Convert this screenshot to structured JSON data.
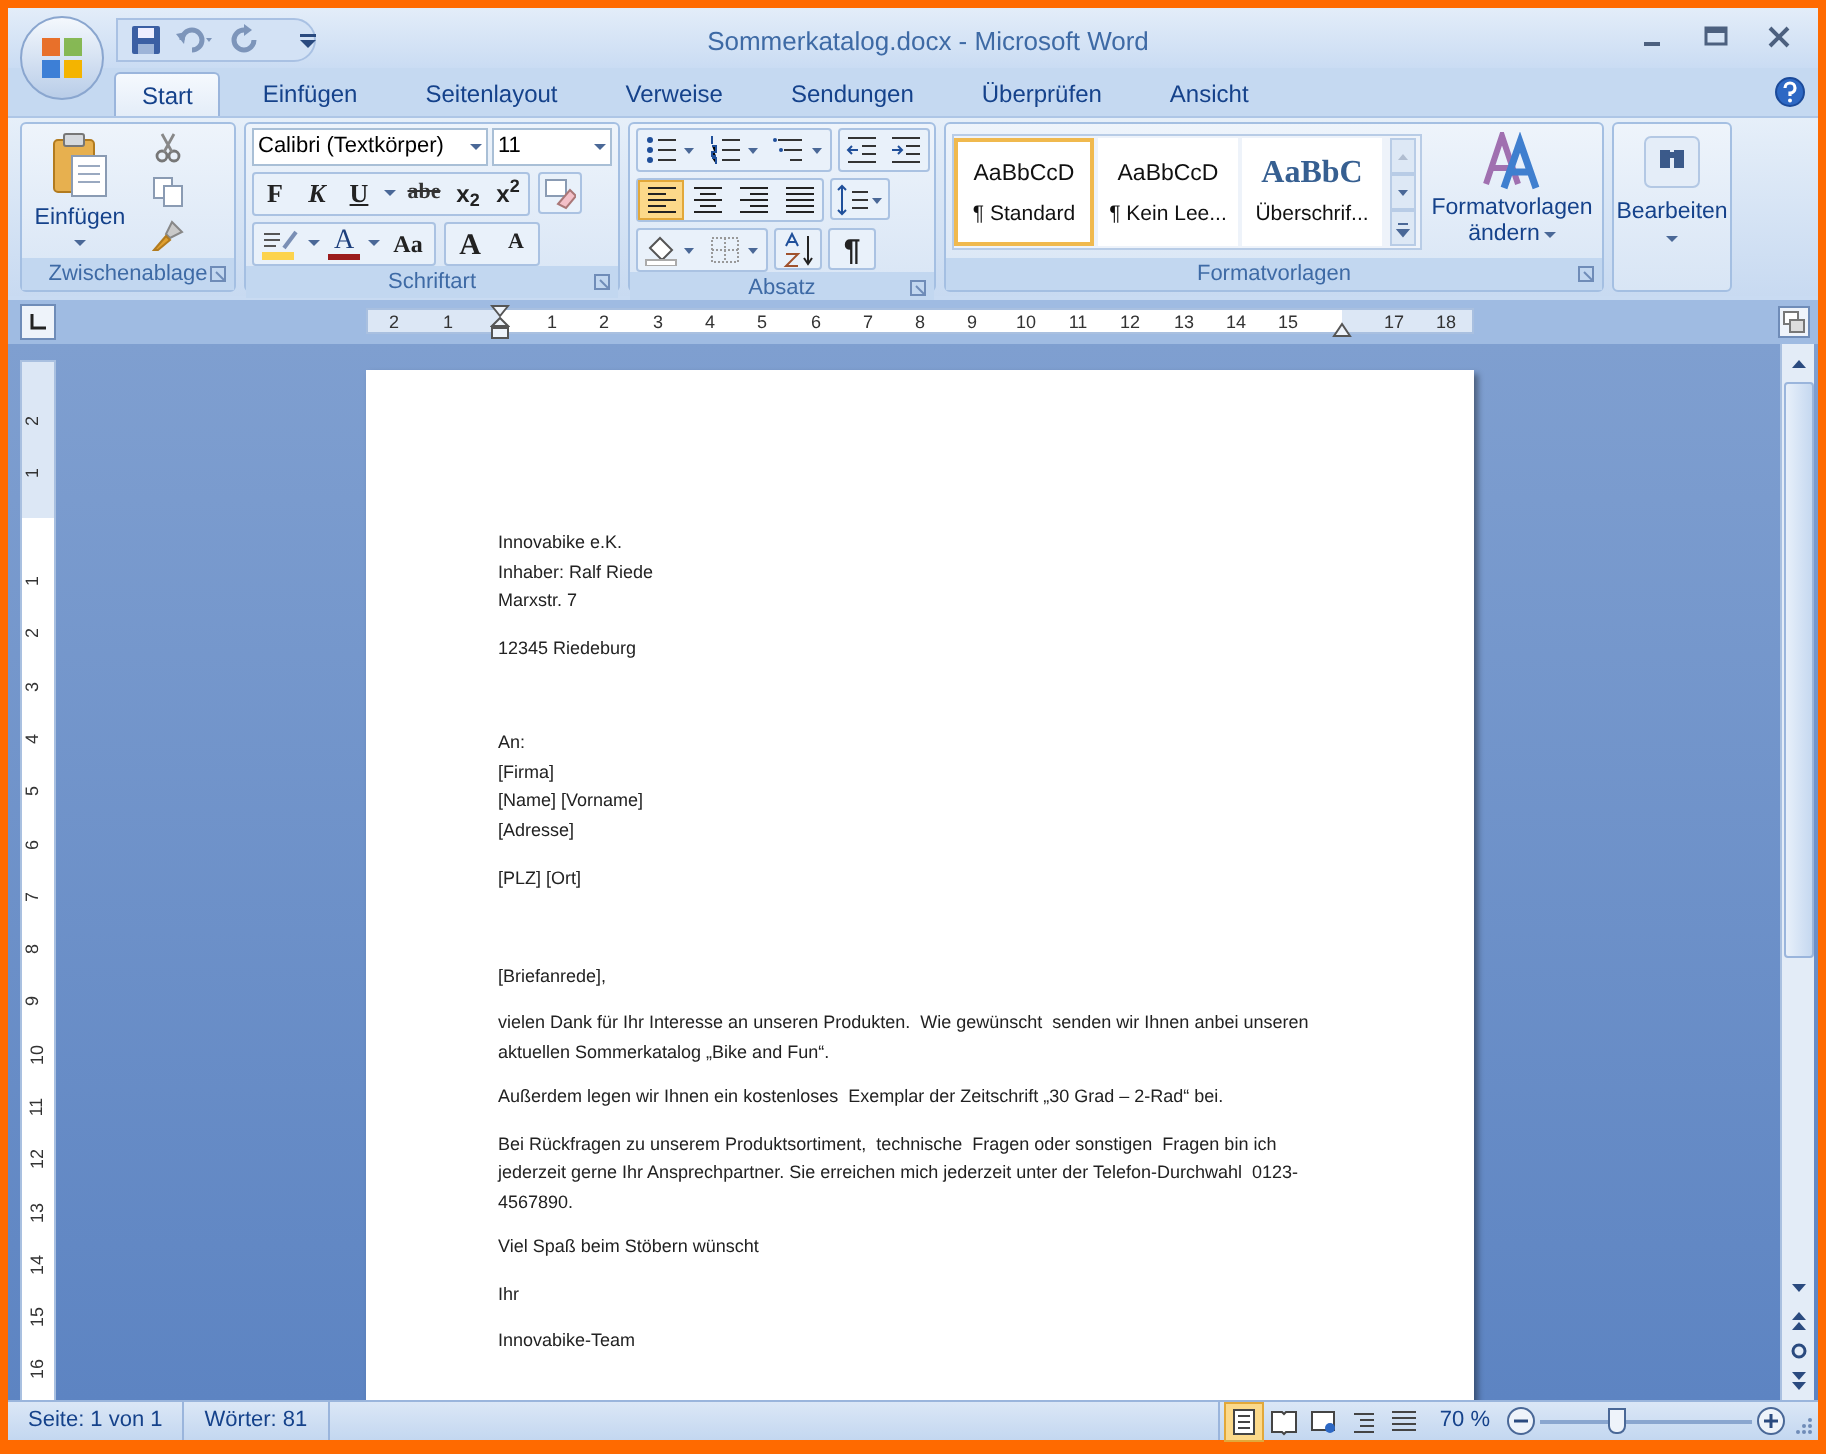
{
  "window": {
    "title": "Sommerkatalog.docx - Microsoft Word"
  },
  "tabs": [
    {
      "label": "Start",
      "selected": true
    },
    {
      "label": "Einfügen",
      "selected": false
    },
    {
      "label": "Seitenlayout",
      "selected": false
    },
    {
      "label": "Verweise",
      "selected": false
    },
    {
      "label": "Sendungen",
      "selected": false
    },
    {
      "label": "Überprüfen",
      "selected": false
    },
    {
      "label": "Ansicht",
      "selected": false
    }
  ],
  "clipboard": {
    "paste": "Einfügen",
    "label": "Zwischenablage"
  },
  "font": {
    "family": "Calibri (Textkörper)",
    "size": "11",
    "bold": "F",
    "italic": "K",
    "underline": "U",
    "strike": "abe",
    "subscript": "x$_{2}$",
    "superscript": "x$^{2}$",
    "color_letter": "A",
    "case": "Aa",
    "grow": "A",
    "shrink": "A",
    "label": "Schriftart"
  },
  "paragraph": {
    "label": "Absatz",
    "pilcrow": "¶",
    "align_buttons": [
      {
        "selected": true
      },
      {
        "selected": false
      },
      {
        "selected": false
      },
      {
        "selected": false
      }
    ]
  },
  "styles": {
    "items": [
      {
        "kind": "body",
        "preview": "AaBbCcD",
        "name": "¶ Standard",
        "selected": true
      },
      {
        "kind": "body",
        "preview": "AaBbCcD",
        "name": "¶ Kein Lee...",
        "selected": false
      },
      {
        "kind": "heading",
        "preview": "AaBbC",
        "name": "Überschrif...",
        "selected": false
      }
    ],
    "change": "Formatvorlagen",
    "change_2": "ändern",
    "label": "Formatvorlagen"
  },
  "editing": {
    "label": "Bearbeiten"
  },
  "ruler": {
    "labels": [
      "2",
      "1",
      "1",
      "2",
      "3",
      "4",
      "5",
      "6",
      "7",
      "8",
      "9",
      "10",
      "11",
      "12",
      "13",
      "14",
      "15",
      "17",
      "18"
    ]
  },
  "vertical_ruler": {
    "labels": [
      "2",
      "1",
      "1",
      "2",
      "3",
      "4",
      "5",
      "6",
      "7",
      "8",
      "9",
      "10",
      "11",
      "12",
      "13",
      "14",
      "15",
      "16"
    ]
  },
  "document": {
    "blocks": [
      {
        "lines": [
          "Innovabike e.K.",
          "Inhaber: Ralf Riede",
          "Marxstr. 7"
        ]
      },
      {
        "lines": [
          "12345 Riedeburg"
        ]
      },
      {
        "lines": [
          "An:",
          "[Firma]",
          "[Name] [Vorname]",
          "[Adresse]"
        ]
      },
      {
        "lines": [
          "[PLZ] [Ort]"
        ]
      },
      {
        "lines": [
          "[Briefanrede],"
        ]
      },
      {
        "lines": [
          "vielen Dank für Ihr Interesse an unseren Produkten.  Wie gewünscht  senden wir Ihnen anbei unseren",
          "aktuellen Sommerkatalog „Bike and Fun“."
        ]
      },
      {
        "lines": [
          "Außerdem legen wir Ihnen ein kostenloses  Exemplar der Zeitschrift „30 Grad – 2-Rad“ bei."
        ]
      },
      {
        "lines": [
          "Bei Rückfragen zu unserem Produktsortiment,  technische  Fragen oder sonstigen  Fragen bin ich",
          "jederzeit gerne Ihr Ansprechpartner. Sie erreichen mich jederzeit unter der Telefon-Durchwahl  0123-",
          "4567890."
        ]
      },
      {
        "lines": [
          "Viel Spaß beim Stöbern wünscht"
        ]
      },
      {
        "lines": [
          "Ihr"
        ]
      },
      {
        "lines": [
          "Innovabike-Team"
        ]
      }
    ]
  },
  "status_bar": {
    "page": "Seite: 1 von 1",
    "words": "Wörter: 81",
    "views": [
      {
        "selected": true
      },
      {
        "selected": false
      },
      {
        "selected": false
      },
      {
        "selected": false
      },
      {
        "selected": false
      }
    ],
    "zoom": "70 %",
    "zoom_slider": {
      "level": 0.36
    }
  }
}
